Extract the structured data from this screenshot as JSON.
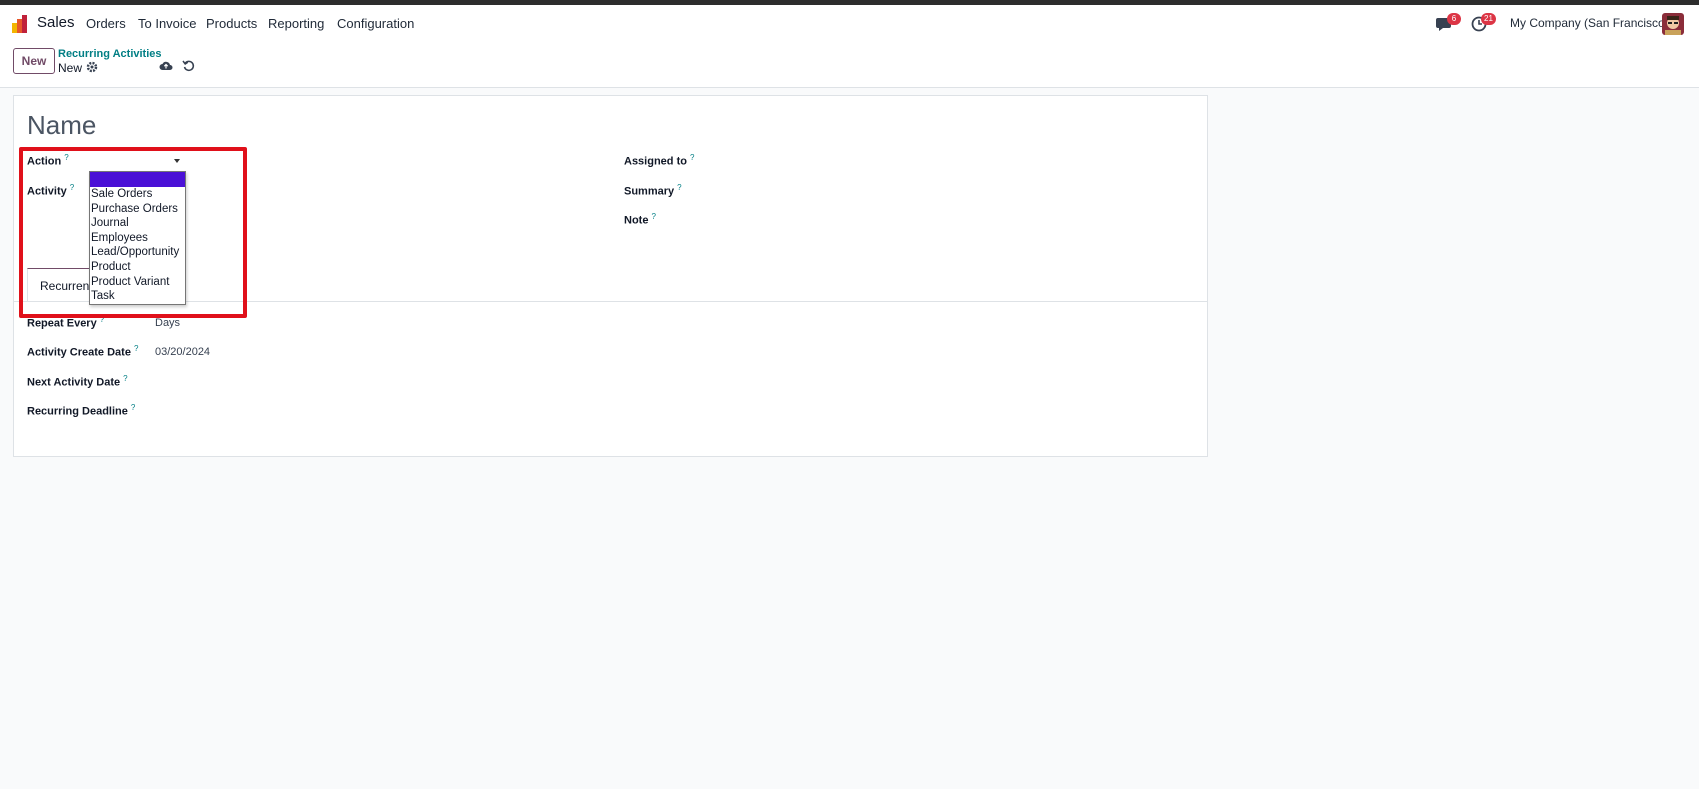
{
  "navbar": {
    "app_name": "Sales",
    "menu": [
      "Orders",
      "To Invoice",
      "Products",
      "Reporting",
      "Configuration"
    ],
    "messages_badge": "6",
    "activities_badge": "21",
    "company": "My Company (San Francisco)",
    "icons": [
      "sales-app-logo-icon",
      "chat-icon",
      "clock-icon",
      "user-avatar"
    ]
  },
  "control": {
    "new_label": "New",
    "breadcrumb_parent": "Recurring Activities",
    "breadcrumb_current": "New",
    "icons": [
      "gear-icon",
      "save-cloud-icon",
      "discard-undo-icon"
    ]
  },
  "form": {
    "title_placeholder": "Name",
    "action_label": "Action",
    "activity_label": "Activity",
    "assigned_label": "Assigned to",
    "summary_label": "Summary",
    "note_label": "Note",
    "help_mark": "?",
    "tab_label": "Recurrent",
    "repeat_label": "Repeat Every",
    "repeat_value": "Days",
    "create_date_label": "Activity Create Date",
    "create_date_value": "03/20/2024",
    "next_date_label": "Next Activity Date",
    "deadline_label": "Recurring Deadline"
  },
  "dropdown": {
    "options": [
      "",
      "Sale Orders",
      "Purchase Orders",
      "Journal",
      "Employees",
      "Lead/Opportunity",
      "Product",
      "Product Variant",
      "Task"
    ],
    "selected_index": 0
  },
  "colors": {
    "brand": "#714b67",
    "link": "#017e84",
    "badge": "#dc3545",
    "selection": "#4a10d6",
    "highlight_box": "#e0101a"
  }
}
